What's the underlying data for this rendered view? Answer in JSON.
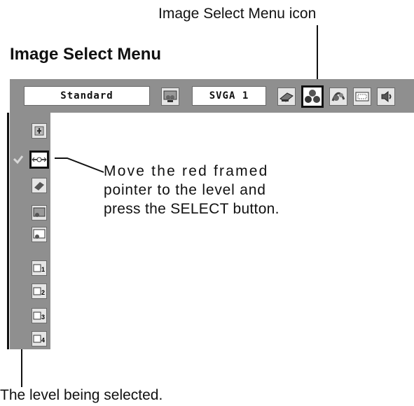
{
  "callouts": {
    "menu_icon": "Image Select Menu icon",
    "level_selected": "The level being selected."
  },
  "title": "Image Select Menu",
  "menubar": {
    "mode_field": "Standard",
    "resolution_field": "SVGA 1",
    "icons": [
      "input-icon",
      "pc-adjust-icon",
      "image-select-icon",
      "image-adjust-icon",
      "screen-icon",
      "sound-icon"
    ],
    "selected_icon": "image-select-icon"
  },
  "levels": {
    "items": [
      "dynamic",
      "standard",
      "real",
      "blackboard-green",
      "colorboard",
      "image-1",
      "image-2",
      "image-3",
      "image-4"
    ],
    "labels": [
      "",
      "",
      "",
      "",
      "",
      "1",
      "2",
      "3",
      "4"
    ],
    "selected_index": 1
  },
  "instruction": {
    "line1": "Move the red framed",
    "line2": "pointer to the level and",
    "line3": "press the SELECT button."
  },
  "colors": {
    "bar_gray": "#8f8f8f",
    "icon_bg": "#e5e5e5",
    "frame": "#111111"
  }
}
